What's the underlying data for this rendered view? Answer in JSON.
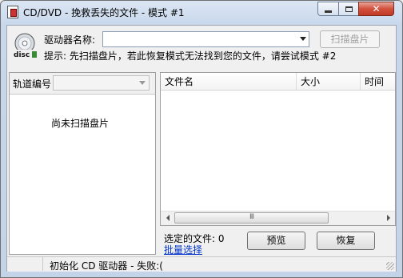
{
  "window": {
    "title": "CD/DVD - 挽救丢失的文件 - 模式 #1",
    "close_glyph": "✕"
  },
  "drive": {
    "label": "驱动器名称:",
    "selected": "",
    "scan_button": "扫描盘片",
    "hint": "提示: 先扫描盘片，若此恢复模式无法找到您的文件，请尝试模式 #2"
  },
  "icons": {
    "disc_text": "disc",
    "app_icon": "recovery-app-icon"
  },
  "left_panel": {
    "track_label": "轨道编号",
    "track_selected": "",
    "empty_message": "尚未扫描盘片"
  },
  "file_list": {
    "columns": [
      "文件名",
      "大小",
      "时间"
    ],
    "scroll_thumb": "III"
  },
  "footer": {
    "selected_files": "选定的文件: 0",
    "batch_select": "批量选择",
    "preview_button": "预览",
    "recover_button": "恢复"
  },
  "status": {
    "text": "初始化 CD 驱动器 - 失败:("
  },
  "colors": {
    "title_gradient": "#c8d8ec",
    "close_button": "#c13a26",
    "link": "#0033cc"
  }
}
